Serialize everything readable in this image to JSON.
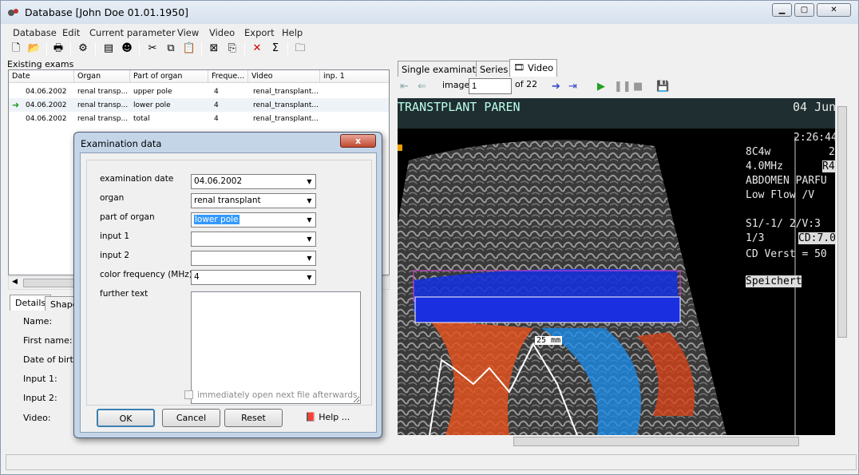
{
  "window": {
    "title": "Database [John Doe 01.01.1950]"
  },
  "menu": [
    "Database",
    "Edit",
    "Current parameter",
    "View",
    "Video",
    "Export",
    "Help"
  ],
  "left": {
    "existing_label": "Existing exams",
    "columns": [
      "Date",
      "Organ",
      "Part of organ",
      "Freque...",
      "Video",
      "inp. 1"
    ],
    "rows": [
      {
        "date": "04.06.2002",
        "organ": "renal transp...",
        "part": "upper pole",
        "freq": "4",
        "video": "renal_transplant...",
        "current": false
      },
      {
        "date": "04.06.2002",
        "organ": "renal transp...",
        "part": "lower pole",
        "freq": "4",
        "video": "renal_transplant...",
        "current": true
      },
      {
        "date": "04.06.2002",
        "organ": "renal transp...",
        "part": "total",
        "freq": "4",
        "video": "renal_transplant...",
        "current": false
      }
    ],
    "tabs": [
      "Details",
      "Shape"
    ],
    "detail_labels": [
      "Name:",
      "First name:",
      "Date of birth:",
      "Input 1:",
      "Input 2:",
      "Video:"
    ]
  },
  "right": {
    "tabs": [
      "Single examination",
      "Series",
      "Video"
    ],
    "image_label": "image",
    "image_value": "1",
    "image_of": "of 22",
    "video_overlay": {
      "title": "TRANSTPLANT PAREN",
      "date": "04 Jun",
      "time": "2:26:44",
      "probe": "8C4w",
      "probe_val": "2",
      "freq": "4.0MHz",
      "freq_val": "R4",
      "preset": "ABDOMEN PARFU",
      "flow": "Low Flow /V",
      "s1": "S1/-1/  2/V:3",
      "ratio": "1/3",
      "cd": "CD:7.0",
      "cd_verst": "CD Verst = 50",
      "speichert": "Speichert",
      "measure": "25 mm"
    }
  },
  "dialog": {
    "title": "Examination data",
    "close": "x",
    "fields": [
      {
        "label": "examination date",
        "value": "04.06.2002",
        "selected": false
      },
      {
        "label": "organ",
        "value": "renal transplant",
        "selected": false
      },
      {
        "label": "part of organ",
        "value": "lower pole",
        "selected": true
      },
      {
        "label": "input 1",
        "value": "",
        "selected": false
      },
      {
        "label": "input 2",
        "value": "",
        "selected": false
      },
      {
        "label": "color frequency (MHz)",
        "value": "4",
        "selected": false
      }
    ],
    "further_text_label": "further text",
    "checkbox_label": "immediately open next file afterwards",
    "buttons": {
      "ok": "OK",
      "cancel": "Cancel",
      "reset": "Reset",
      "help": "Help ..."
    }
  },
  "colors": {
    "title_bg": "#d6e1ee",
    "dialog_frame": "#c4d5e8",
    "selection": "#3399ff",
    "video_header": "#1f2e30"
  }
}
